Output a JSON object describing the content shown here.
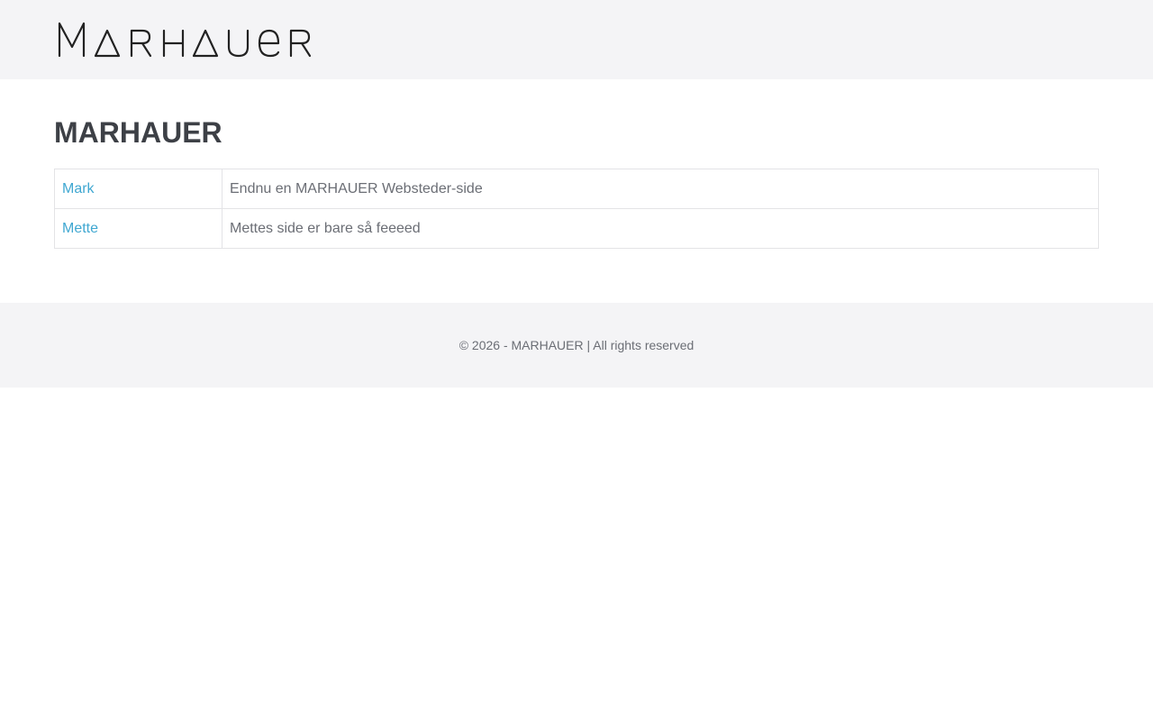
{
  "header": {
    "logo_text": "MARHAUER",
    "logo_icon": "marhauer-wordmark-logo"
  },
  "main": {
    "title": "MARHAUER",
    "sites": [
      {
        "name": "Mark",
        "description": "Endnu en MARHAUER Websteder-side"
      },
      {
        "name": "Mette",
        "description": "Mettes side er bare så feeeed"
      }
    ]
  },
  "footer": {
    "text": "© 2026 - MARHAUER | All rights reserved"
  },
  "colors": {
    "header_bg": "#f4f4f6",
    "link": "#3fa7d1",
    "title": "#3d4046",
    "muted_text": "#6b6e75",
    "border": "#e3e3e6"
  }
}
